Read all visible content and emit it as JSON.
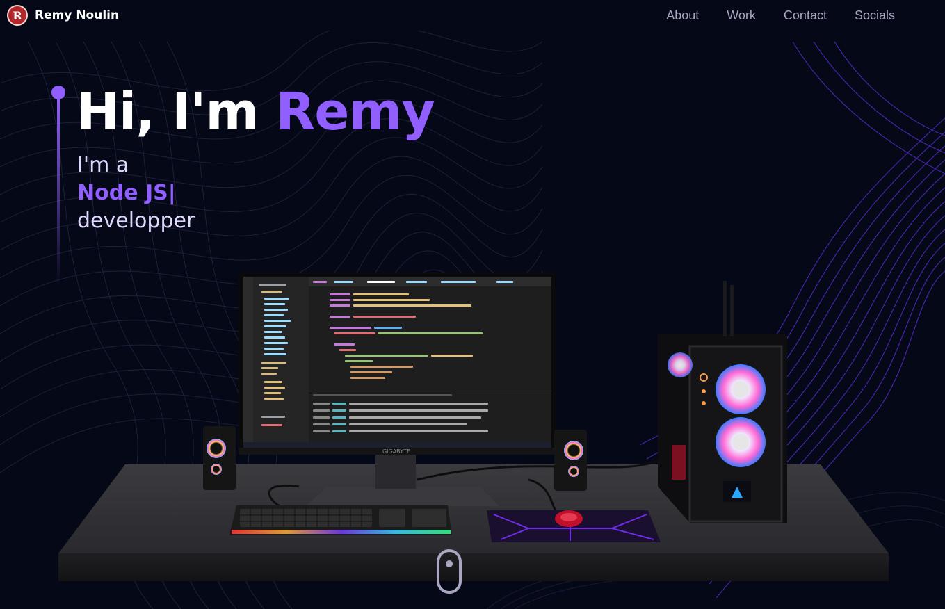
{
  "brand": {
    "logo_letter": "R",
    "name": "Remy Noulin"
  },
  "nav": {
    "links": [
      "About",
      "Work",
      "Contact",
      "Socials"
    ]
  },
  "hero": {
    "greeting": "Hi, I'm",
    "name": "Remy",
    "intro": "I'm a",
    "role": "Node JS|",
    "suffix": "developper"
  },
  "scene": {
    "monitor_brand": "GIGABYTE"
  },
  "colors": {
    "background": "#050816",
    "accent": "#915eff",
    "nav_text": "#aaa6c3",
    "white": "#ffffff"
  },
  "icons": {
    "logo": "r-logo-icon",
    "scroll": "mouse-scroll-icon"
  }
}
